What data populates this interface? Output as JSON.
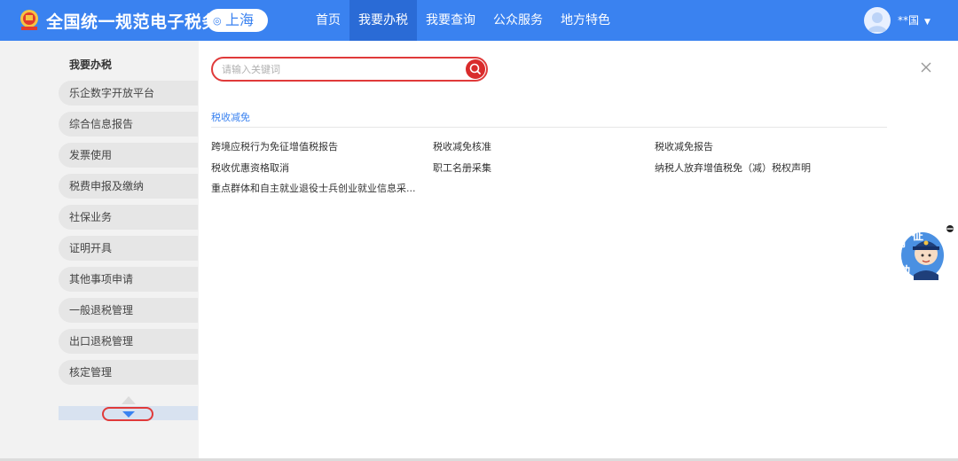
{
  "header": {
    "title": "全国统一规范电子税务局",
    "region": "上海",
    "nav": [
      "首页",
      "我要办税",
      "我要查询",
      "公众服务",
      "地方特色"
    ],
    "active_nav": "我要办税",
    "user": "**国",
    "colors": {
      "topbar": "#3a82f0",
      "active": "#2a6bd6"
    }
  },
  "sidebar": {
    "title": "我要办税",
    "items": [
      {
        "label": "乐企数字开放平台"
      },
      {
        "label": "综合信息报告"
      },
      {
        "label": "发票使用"
      },
      {
        "label": "税费申报及缴纳"
      },
      {
        "label": "社保业务"
      },
      {
        "label": "证明开具"
      },
      {
        "label": "其他事项申请"
      },
      {
        "label": "一般退税管理"
      },
      {
        "label": "出口退税管理"
      },
      {
        "label": "核定管理"
      }
    ]
  },
  "search": {
    "placeholder": "请输入关键词",
    "value": ""
  },
  "content": {
    "section_title": "税收减免",
    "links": [
      {
        "label": "跨境应税行为免征增值税报告"
      },
      {
        "label": "税收减免核准"
      },
      {
        "label": "税收减免报告"
      },
      {
        "label": "税收优惠资格取消"
      },
      {
        "label": "职工名册采集"
      },
      {
        "label": "纳税人放弃增值税免（减）税权声明"
      },
      {
        "label": "重点群体和自主就业退役士兵创业就业信息采..."
      }
    ]
  },
  "mascot": {
    "text": [
      "征",
      "纳",
      "互",
      "动"
    ],
    "colors": {
      "bubble": "#4a90e2",
      "accent": "#1f5fbf"
    }
  },
  "icons": {
    "logo": "tax-emblem-icon",
    "region": "location-pin-icon",
    "avatar": "user-avatar-icon",
    "user_menu": "chevron-down-icon",
    "search": "search-icon",
    "close": "close-icon",
    "scroll_down": "triangle-down-icon"
  }
}
